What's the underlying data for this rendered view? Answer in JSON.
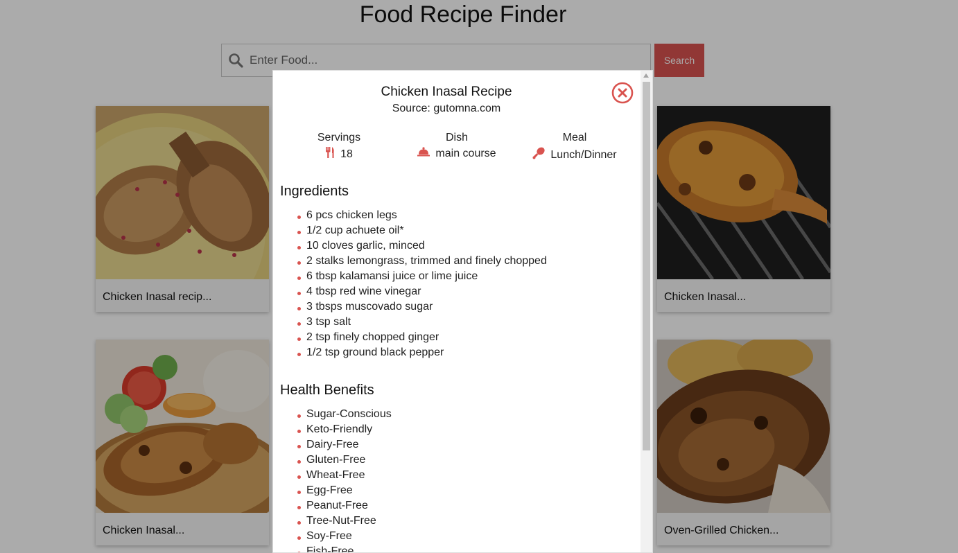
{
  "app": {
    "title": "Food Recipe Finder"
  },
  "search": {
    "placeholder": "Enter Food...",
    "value": "",
    "button_label": "Search"
  },
  "cards": [
    {
      "label": "Chicken Inasal recip..."
    },
    {
      "label": "Chicken Inasal..."
    },
    {
      "label": "Chicken Inasal..."
    },
    {
      "label": "Oven-Grilled Chicken..."
    }
  ],
  "modal": {
    "title": "Chicken Inasal Recipe",
    "source": "Source: gutomna.com",
    "servings": {
      "label": "Servings",
      "value": "18",
      "icon": "utensils-icon"
    },
    "dish": {
      "label": "Dish",
      "value": "main course",
      "icon": "cloche-icon"
    },
    "meal": {
      "label": "Meal",
      "value": "Lunch/Dinner",
      "icon": "drumstick-icon"
    },
    "ingredients_heading": "Ingredients",
    "ingredients": [
      "6 pcs chicken legs",
      "1/2 cup achuete oil*",
      "10 cloves garlic, minced",
      "2 stalks lemongrass, trimmed and finely chopped",
      "6 tbsp kalamansi juice or lime juice",
      "4 tbsp red wine vinegar",
      "3 tbsps muscovado sugar",
      "3 tsp salt",
      "2 tsp finely chopped ginger",
      "1/2 tsp ground black pepper"
    ],
    "health_heading": "Health Benefits",
    "health": [
      "Sugar-Conscious",
      "Keto-Friendly",
      "Dairy-Free",
      "Gluten-Free",
      "Wheat-Free",
      "Egg-Free",
      "Peanut-Free",
      "Tree-Nut-Free",
      "Soy-Free",
      "Fish-Free"
    ]
  },
  "colors": {
    "accent": "#d9534f",
    "overlay": "rgba(0,0,0,0.33)"
  }
}
